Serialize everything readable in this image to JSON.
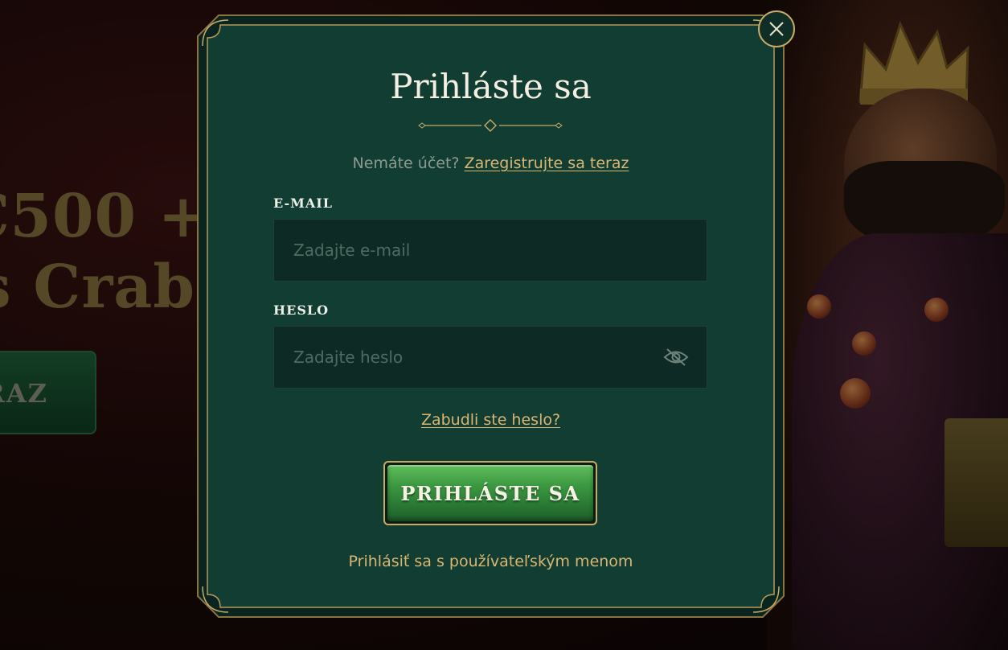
{
  "background_promo": {
    "headline_line1": "€500 +",
    "headline_line2": "s Crab",
    "cta_label": "RAZ"
  },
  "modal": {
    "title": "Prihláste sa",
    "signup_prompt": "Nemáte účet?",
    "signup_link": "Zaregistrujte sa teraz",
    "email": {
      "label": "E-MAIL",
      "placeholder": "Zadajte e-mail",
      "value": ""
    },
    "password": {
      "label": "HESLO",
      "placeholder": "Zadajte heslo",
      "value": "",
      "toggle_icon": "eye-off-icon"
    },
    "forgot_password_link": "Zabudli ste heslo?",
    "submit_label": "PRIHLÁSTE SA",
    "username_login_link": "Prihlásiť sa s používateľským menom",
    "close_icon": "close-icon"
  },
  "colors": {
    "panel": "#113d33",
    "gold_accent": "#d9b672",
    "button_green": "#3c9a42",
    "field_bg": "#0d2a24"
  }
}
